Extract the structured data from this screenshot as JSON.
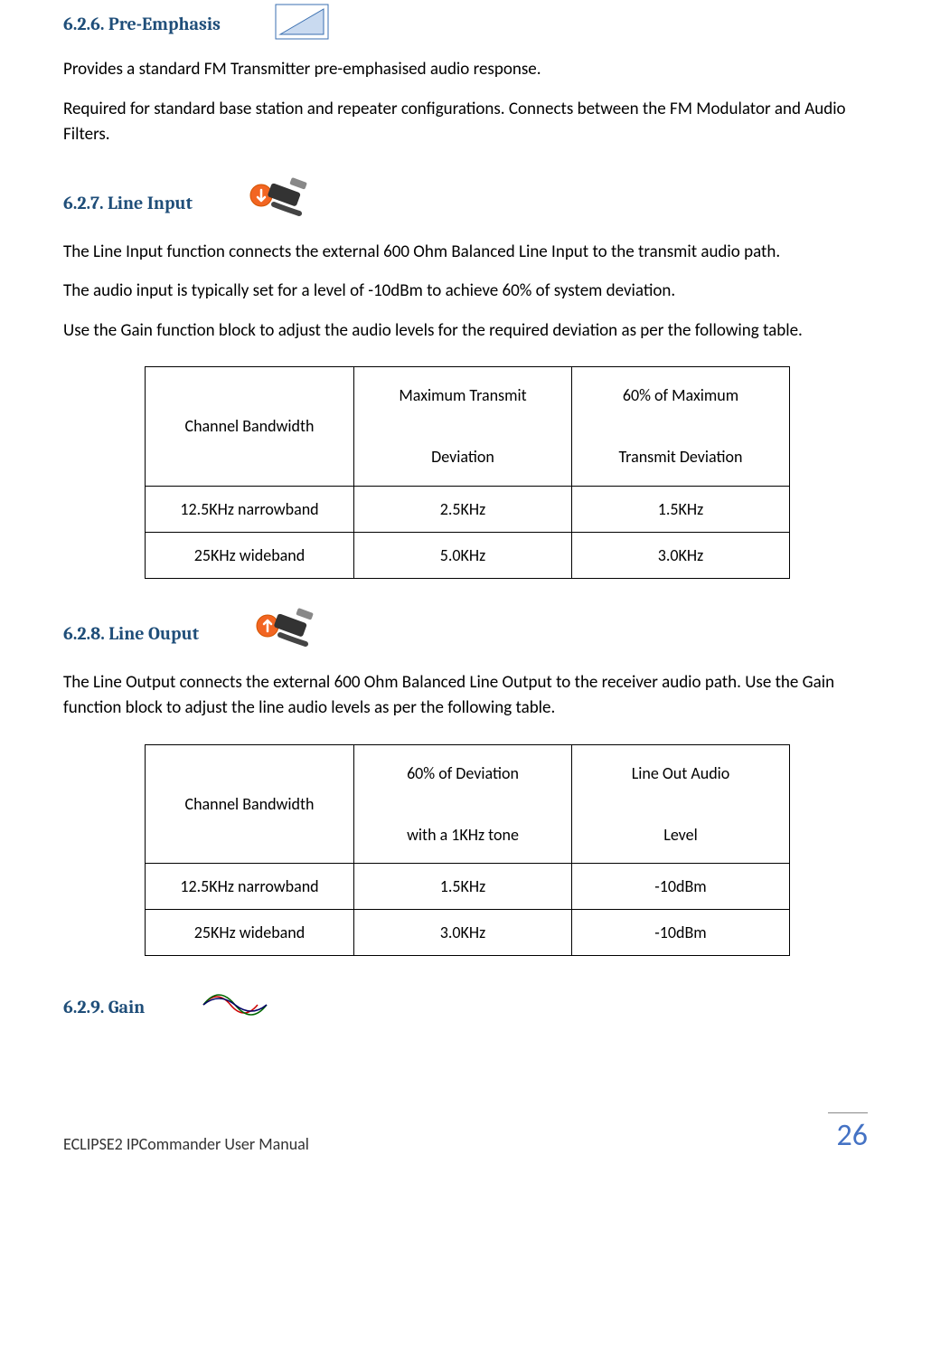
{
  "sections": {
    "preEmphasis": {
      "heading": "6.2.6. Pre-Emphasis",
      "para1": "Provides a standard FM Transmitter pre-emphasised audio response.",
      "para2": "Required for standard base station and repeater configurations. Connects between the FM Modulator and Audio Filters."
    },
    "lineInput": {
      "heading": "6.2.7. Line Input",
      "para1": "The Line Input function connects the external 600 Ohm Balanced Line Input to the transmit audio path.",
      "para2": "The audio input is typically set for a level of -10dBm to achieve 60% of system deviation.",
      "para3": "Use the Gain function block to adjust the audio levels for the required deviation as per the following table.",
      "table": {
        "h1": "Channel Bandwidth",
        "h2a": "Maximum Transmit",
        "h2b": "Deviation",
        "h3a": "60% of Maximum",
        "h3b": "Transmit Deviation",
        "r1c1": "12.5KHz narrowband",
        "r1c2": "2.5KHz",
        "r1c3": "1.5KHz",
        "r2c1": "25KHz wideband",
        "r2c2": "5.0KHz",
        "r2c3": "3.0KHz"
      }
    },
    "lineOutput": {
      "heading": "6.2.8. Line Ouput",
      "para1": "The Line Output connects the external 600 Ohm Balanced Line Output to the receiver audio path. Use the Gain function block to adjust the line audio levels as per the following table.",
      "table": {
        "h1": "Channel Bandwidth",
        "h2a": "60% of Deviation",
        "h2b": "with a 1KHz tone",
        "h3a": "Line Out Audio",
        "h3b": "Level",
        "r1c1": "12.5KHz narrowband",
        "r1c2": "1.5KHz",
        "r1c3": "-10dBm",
        "r2c1": "25KHz wideband",
        "r2c2": "3.0KHz",
        "r2c3": "-10dBm"
      }
    },
    "gain": {
      "heading": "6.2.9. Gain"
    }
  },
  "footer": {
    "left": "ECLIPSE2 IPCommander User Manual",
    "right": "26"
  }
}
